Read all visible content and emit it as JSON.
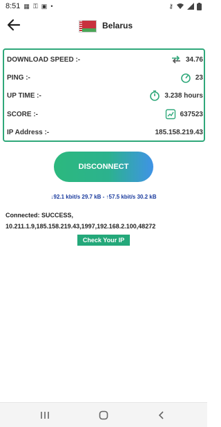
{
  "status_bar": {
    "time": "8:51",
    "left_icons": [
      "grid-icon",
      "key-icon",
      "image-icon",
      "dot-icon"
    ],
    "right_icons": [
      "vpn-key-icon",
      "wifi-icon",
      "signal-icon",
      "battery-icon"
    ]
  },
  "header": {
    "country": "Belarus",
    "flag_colors": {
      "red": "#c8313e",
      "green": "#4aa657"
    }
  },
  "stats": [
    {
      "label": "DOWNLOAD SPEED :-",
      "value": "34.76",
      "icon": "speed-arrows-icon"
    },
    {
      "label": "PING :-",
      "value": "23",
      "icon": "speedometer-icon"
    },
    {
      "label": "UP TIME :-",
      "value": "3.238 hours",
      "icon": "timer-icon"
    },
    {
      "label": "SCORE :-",
      "value": "637523",
      "icon": "score-chart-icon"
    },
    {
      "label": "IP Address :-",
      "value": "185.158.219.43",
      "icon": ""
    }
  ],
  "disconnect_label": "DISCONNECT",
  "traffic_text": "↓92.1 kbit/s 29.7 kB - ↑57.5 kbit/s 30.2 kB",
  "connection": {
    "line1": "Connected: SUCCESS,",
    "line2": "10.211.1.9,185.158.219.43,1997,192.168.2.100,48272"
  },
  "check_ip_label": "Check Your IP",
  "accent_color": "#2fa87a",
  "nav_bar": {
    "buttons": [
      "recents-icon",
      "home-icon",
      "back-nav-icon"
    ]
  }
}
